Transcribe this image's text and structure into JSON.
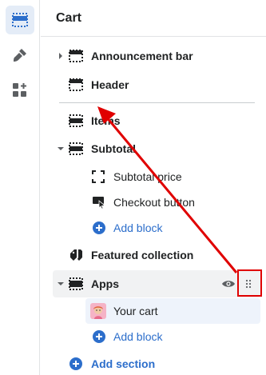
{
  "rail": {
    "items": [
      {
        "name": "sections",
        "icon": "layout-icon",
        "active": true
      },
      {
        "name": "theme-settings",
        "icon": "paint-brush-icon",
        "active": false
      },
      {
        "name": "apps",
        "icon": "apps-add-icon",
        "active": false
      }
    ]
  },
  "panel": {
    "title": "Cart",
    "rows": {
      "announcement": "Announcement bar",
      "header": "Header",
      "items": "Items",
      "subtotal": "Subtotal",
      "subtotal_price": "Subtotal price",
      "checkout_button": "Checkout button",
      "add_block_1": "Add block",
      "featured_collection": "Featured collection",
      "apps": "Apps",
      "your_cart": "Your cart",
      "add_block_2": "Add block",
      "add_section": "Add section"
    }
  },
  "colors": {
    "accent": "#2c6ecb",
    "annotation": "#e00000",
    "active_rail_bg": "#e4ecf7",
    "selected_bg": "#eef3fb"
  }
}
